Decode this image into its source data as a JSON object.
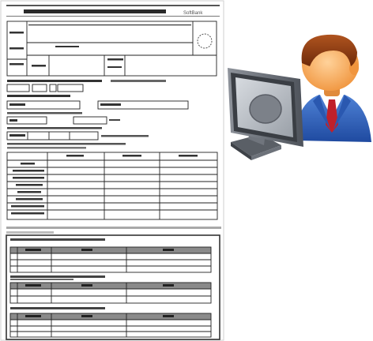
{
  "form": {
    "brand": "SoftBank",
    "title_text": "",
    "blurred": true
  },
  "illustration": {
    "subject": "person-at-computer",
    "icons": [
      "monitor-icon",
      "person-icon"
    ]
  },
  "colors": {
    "paper": "#ffffff",
    "ink": "#1a1a1a",
    "gray_band": "#a8a8a8",
    "suit_blue": "#2f5fb8",
    "tie_red": "#c0202a",
    "skin": "#f4a45a",
    "hair": "#8a3a12",
    "monitor_gray": "#6a6f78"
  }
}
